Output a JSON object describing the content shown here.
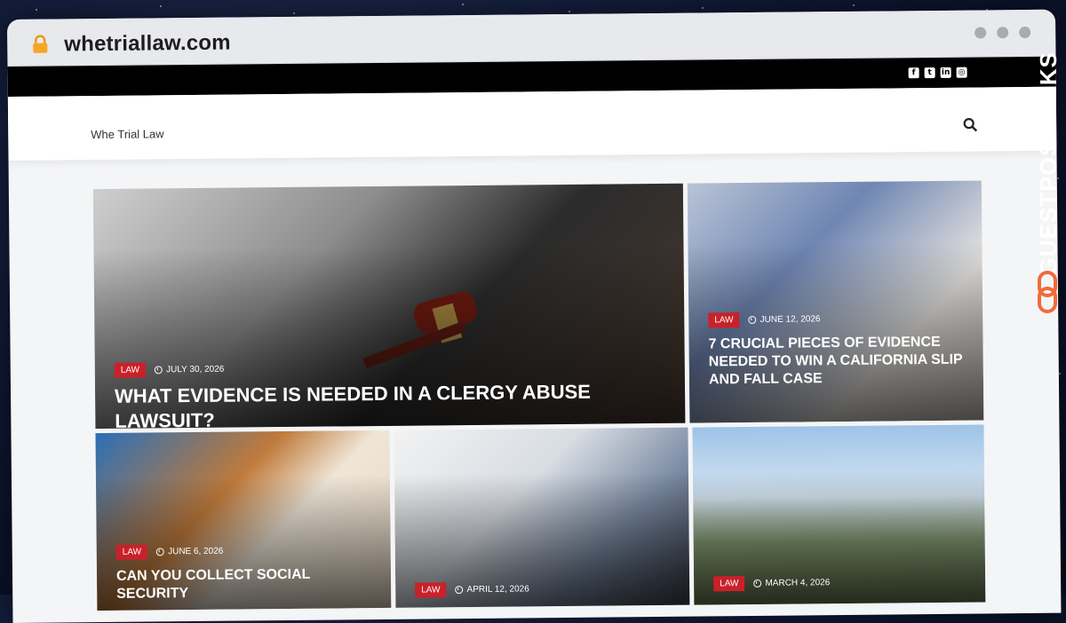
{
  "browser": {
    "url": "whetriallaw.com"
  },
  "header": {
    "site_title": "Whe Trial Law"
  },
  "watermark": {
    "text": "GUESTPOSTLINKS",
    "accent": "#f26b3a"
  },
  "colors": {
    "badge": "#c8212a",
    "topbar": "#000000"
  },
  "social_icons": [
    "facebook-icon",
    "twitter-icon",
    "linkedin-icon",
    "instagram-icon"
  ],
  "posts": [
    {
      "category": "LAW",
      "date": "JULY 30, 2026",
      "title": "WHAT EVIDENCE IS NEEDED IN A CLERGY ABUSE LAWSUIT?"
    },
    {
      "category": "LAW",
      "date": "JUNE 12, 2026",
      "title": "7 CRUCIAL PIECES OF EVIDENCE NEEDED TO WIN A CALIFORNIA SLIP AND FALL CASE"
    },
    {
      "category": "LAW",
      "date": "JUNE 6, 2026",
      "title": "CAN YOU COLLECT SOCIAL SECURITY"
    },
    {
      "category": "LAW",
      "date": "APRIL 12, 2026",
      "title": ""
    },
    {
      "category": "LAW",
      "date": "MARCH 4, 2026",
      "title": ""
    }
  ]
}
